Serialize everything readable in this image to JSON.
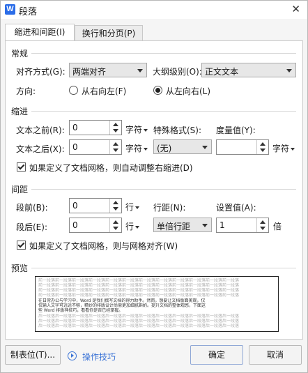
{
  "window": {
    "app_icon_letter": "W",
    "title": "段落",
    "close_glyph": "✕"
  },
  "tabs": [
    {
      "label": "缩进和间距(I)",
      "active": true
    },
    {
      "label": "换行和分页(P)",
      "active": false
    }
  ],
  "general": {
    "heading": "常规",
    "alignment_label": "对齐方式(G):",
    "alignment_value": "两端对齐",
    "outline_label": "大纲级别(O):",
    "outline_value": "正文文本",
    "direction_label": "方向:",
    "rtl_label": "从右向左(F)",
    "ltr_label": "从左向右(L)",
    "selected_direction": "ltr"
  },
  "indent": {
    "heading": "缩进",
    "before_label": "文本之前(R):",
    "before_value": "0",
    "before_unit": "字符",
    "after_label": "文本之后(X):",
    "after_value": "0",
    "after_unit": "字符",
    "special_label": "特殊格式(S):",
    "special_value": "(无)",
    "measure_label": "度量值(Y):",
    "measure_value": "",
    "measure_unit": "字符",
    "auto_adjust_label": "如果定义了文档网格，则自动调整右缩进(D)",
    "auto_adjust_checked": true
  },
  "spacing": {
    "heading": "间距",
    "before_label": "段前(B):",
    "before_value": "0",
    "before_unit": "行",
    "after_label": "段后(E):",
    "after_value": "0",
    "after_unit": "行",
    "line_label": "行距(N):",
    "line_value": "单倍行距",
    "setting_label": "设置值(A):",
    "setting_value": "1",
    "setting_unit": "倍",
    "snap_grid_label": "如果定义了文档网格，则与网格对齐(W)",
    "snap_grid_checked": true
  },
  "preview": {
    "heading": "预览",
    "prev_line": "前一段落前一段落前一段落前一段落前一段落前一段落前一段落前一段落前一段落前一段落前一段落前一段落",
    "sample_1": "在日常办公与学习中，Word 是我们撰写文档的得力助手。然而，想要让文档版面美观，仅",
    "sample_2": "仅输入文字可远远不够，精妙的排版设计尚需更加细腻斟酌。提升文档的整体观感，下面这",
    "sample_3": "些 Word 排版神技巧，看看你是否已经掌握。",
    "next_line": "后一段落后一段落后一段落后一段落后一段落后一段落后一段落后一段落后一段落后一段落后一段落后一段落"
  },
  "footer": {
    "tabs_button": "制表位(T)...",
    "tips_link": "操作技巧",
    "ok_button": "确定",
    "cancel_button": "取消"
  },
  "colors": {
    "accent": "#3a73d6",
    "app_icon": "#2b6de8"
  }
}
